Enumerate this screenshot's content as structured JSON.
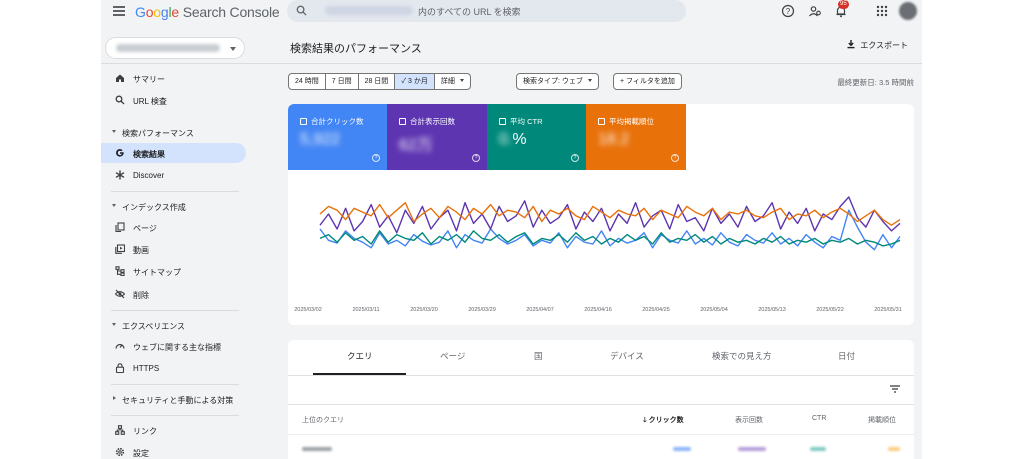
{
  "header": {
    "logo": {
      "google": [
        "G",
        "o",
        "o",
        "g",
        "l",
        "e"
      ],
      "product": "Search Console"
    },
    "search_placeholder": "内のすべての URL を検索",
    "notification_count": "95",
    "icons": [
      "menu-icon",
      "search-icon",
      "help-icon",
      "users-icon",
      "bell-icon",
      "apps-icon"
    ]
  },
  "sidebar": {
    "items": {
      "summary": "サマリー",
      "url_inspection": "URL 検査",
      "performance_section": "検索パフォーマンス",
      "search_results": "検索結果",
      "discover": "Discover",
      "indexing_section": "インデックス作成",
      "pages": "ページ",
      "videos": "動画",
      "sitemaps": "サイトマップ",
      "removals": "削除",
      "experience_section": "エクスペリエンス",
      "core_web_vitals": "ウェブに関する主な指標",
      "https": "HTTPS",
      "security_section": "セキュリティと手動による対策",
      "links": "リンク",
      "settings": "設定"
    }
  },
  "main": {
    "title": "検索結果のパフォーマンス",
    "export_label": "エクスポート",
    "date_ranges": [
      "24 時間",
      "7 日間",
      "28 日間",
      "3 か月",
      "詳細"
    ],
    "selected_range": "3 か月",
    "search_type_chip": "検索タイプ: ウェブ",
    "add_filter_chip": "フィルタを追加",
    "last_updated": "最終更新日: 3.5 時間前",
    "metrics": [
      {
        "label": "合計クリック数",
        "value": "5,922",
        "color": "#4285f4"
      },
      {
        "label": "合計表示回数",
        "value": "62万",
        "color": "#5e35b1"
      },
      {
        "label": "平均 CTR",
        "value_blurred": "0.",
        "value_suffix": "%",
        "color": "#00897b"
      },
      {
        "label": "平均掲載順位",
        "value": "18.2",
        "color": "#e8710a"
      }
    ],
    "tabs": [
      "クエリ",
      "ページ",
      "国",
      "デバイス",
      "検索での見え方",
      "日付"
    ],
    "table_headers": {
      "query": "上位のクエリ",
      "clicks": "クリック数",
      "impressions": "表示回数",
      "ctr": "CTR",
      "position": "掲載順位"
    }
  },
  "chart_data": {
    "type": "line",
    "x_tick_labels": [
      "2025/03/02",
      "2025/03/11",
      "2025/03/20",
      "2025/03/29",
      "2025/04/07",
      "2025/04/16",
      "2025/04/25",
      "2025/05/04",
      "2025/05/13",
      "2025/05/22",
      "2025/05/31"
    ],
    "ylim": [
      0,
      100
    ],
    "grid": false,
    "note": "y values normalized 0-100 (chart shows no y axis)",
    "series": [
      {
        "color": "#4285f4",
        "values": [
          50,
          38,
          35,
          48,
          40,
          36,
          30,
          46,
          34,
          38,
          32,
          44,
          37,
          33,
          36,
          48,
          30,
          44,
          38,
          35,
          50,
          40,
          34,
          38,
          44,
          32,
          38,
          35,
          46,
          30,
          42,
          36,
          34,
          48,
          32,
          40,
          35,
          38,
          46,
          30,
          44,
          38,
          35,
          48,
          34,
          40,
          33,
          46,
          36,
          32,
          44,
          38,
          35,
          46,
          34,
          40,
          32,
          44,
          36,
          30,
          42,
          38,
          70,
          52,
          36,
          28,
          44,
          30,
          42
        ]
      },
      {
        "color": "#5e35b1",
        "values": [
          54,
          66,
          50,
          72,
          48,
          58,
          76,
          52,
          64,
          46,
          70,
          56,
          74,
          50,
          62,
          70,
          48,
          78,
          56,
          66,
          50,
          74,
          58,
          64,
          80,
          52,
          70,
          56,
          62,
          76,
          50,
          68,
          58,
          72,
          48,
          66,
          56,
          78,
          52,
          64,
          70,
          50,
          76,
          58,
          62,
          48,
          72,
          56,
          66,
          52,
          74,
          58,
          64,
          78,
          50,
          68,
          56,
          72,
          48,
          66,
          60,
          74,
          84,
          62,
          52,
          70,
          58,
          48,
          56
        ]
      },
      {
        "color": "#00897b",
        "values": [
          40,
          44,
          36,
          46,
          38,
          42,
          34,
          48,
          36,
          44,
          40,
          38,
          46,
          34,
          42,
          38,
          44,
          36,
          48,
          40,
          38,
          44,
          36,
          42,
          46,
          34,
          40,
          38,
          44,
          36,
          46,
          38,
          42,
          34,
          40,
          36,
          44,
          38,
          42,
          34,
          46,
          36,
          40,
          38,
          44,
          36,
          42,
          34,
          40,
          36,
          38,
          34,
          40,
          36,
          42,
          34,
          38,
          36,
          40,
          34,
          38,
          36,
          40,
          34,
          38,
          36,
          32,
          34,
          38
        ]
      },
      {
        "color": "#e8710a",
        "values": [
          66,
          74,
          70,
          60,
          72,
          68,
          64,
          76,
          62,
          70,
          78,
          58,
          66,
          72,
          62,
          74,
          68,
          60,
          72,
          66,
          76,
          64,
          70,
          68,
          62,
          74,
          58,
          70,
          66,
          72,
          64,
          60,
          74,
          68,
          62,
          70,
          66,
          64,
          72,
          60,
          70,
          66,
          62,
          74,
          68,
          64,
          72,
          60,
          68,
          66,
          70,
          64,
          62,
          68,
          72,
          60,
          66,
          64,
          70,
          62,
          68,
          72,
          66,
          58,
          64,
          70,
          60,
          54,
          60
        ]
      }
    ]
  },
  "colors": {
    "accent": "#1a73e8",
    "active_bg": "#d3e3fd",
    "app_bg": "#f1f3f4"
  }
}
